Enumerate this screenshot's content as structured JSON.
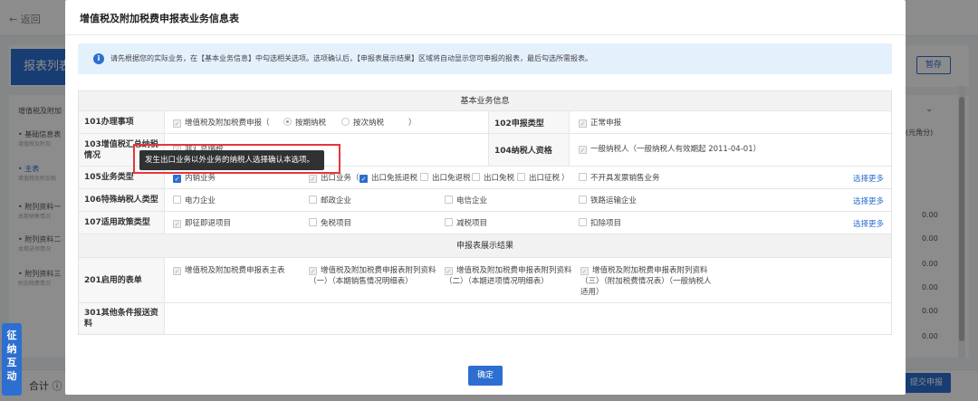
{
  "background": {
    "back_label": "← 返回",
    "page_title": "报表列表",
    "save_label": "暂存",
    "sidebar": [
      {
        "label": "增值税及附加",
        "sub": ""
      },
      {
        "label": "• 基础信息表",
        "sub": "增值税及附加"
      },
      {
        "label": "• 主表",
        "sub": "增值税及附加税"
      },
      {
        "label": "• 附列资料一",
        "sub": "本期销售情况"
      },
      {
        "label": "• 附列资料二",
        "sub": "本期进项情况"
      },
      {
        "label": "• 附列资料三",
        "sub": "附加税费情况"
      }
    ],
    "unit_note": "(元角分)",
    "values": [
      "0.00",
      "0.00",
      "0.00",
      "0.00",
      "0.00",
      "0.00"
    ],
    "total_label": "合计 ⓘ",
    "submit_label": "提交申报",
    "interact_tab": "征纳互动"
  },
  "modal": {
    "title": "增值税及附加税费申报表业务信息表",
    "notice": "请先根据您的实际业务，在【基本业务信息】中勾选相关选项。选项确认后，【申报表展示结果】区域将自动显示您可申报的报表，最后勾选所需报表。",
    "section_basic": "基本业务信息",
    "section_result": "申报表展示结果",
    "row101": {
      "label": "101办理事项",
      "item": "增值税及附加税费申报（",
      "radio1": "按期纳税",
      "radio2": "按次纳税",
      "close": "）"
    },
    "row102": {
      "label": "102申报类型",
      "item": "正常申报"
    },
    "row103": {
      "label": "103增值税汇总纳税情况",
      "item": "非汇总纳税"
    },
    "row104": {
      "label": "104纳税人资格",
      "item": "一般纳税人（一般纳税人有效期起 2011-04-01）"
    },
    "row105": {
      "label": "105业务类型",
      "items": [
        "内销业务",
        "出口业务（",
        "出口免抵退税",
        "出口免退税",
        "出口免税",
        "出口征税",
        "）",
        "不开具发票销售业务"
      ],
      "more": "选择更多"
    },
    "row106": {
      "label": "106特殊纳税人类型",
      "items": [
        "电力企业",
        "邮政企业",
        "电信企业",
        "铁路运输企业"
      ],
      "more": "选择更多"
    },
    "row107": {
      "label": "107适用政策类型",
      "items": [
        "即征即退项目",
        "免税项目",
        "减税项目",
        "扣除项目"
      ],
      "more": "选择更多"
    },
    "row201": {
      "label": "201启用的表单",
      "items": [
        "增值税及附加税费申报表主表",
        "增值税及附加税费申报表附列资料（一）（本期销售情况明细表）",
        "增值税及附加税费申报表附列资料（二）（本期进项情况明细表）",
        "增值税及附加税费申报表附列资料（三）（附加税费情况表）（一般纳税人适用）"
      ]
    },
    "row301": {
      "label": "301其他条件报送资料"
    },
    "tooltip": "发生出口业务以外业务的纳税人选择确认本选项。",
    "confirm_label": "确定"
  },
  "colors": {
    "accent": "#2c6fd1",
    "highlight": "#e8353a",
    "tooltip": "#303133"
  }
}
